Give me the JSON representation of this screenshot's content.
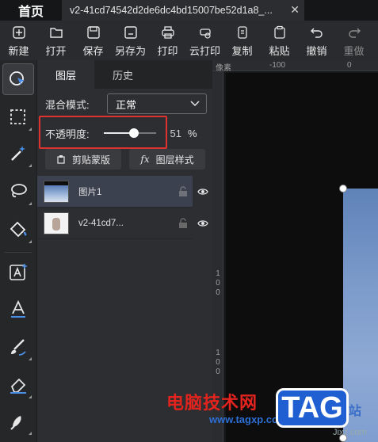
{
  "tabs": {
    "home": "首页",
    "document": "v2-41cd74542d2de6dc4bd15007be52d1a8_..."
  },
  "toolbar": {
    "items": [
      {
        "label": "新建",
        "icon": "new-icon"
      },
      {
        "label": "打开",
        "icon": "folder-open-icon"
      },
      {
        "label": "保存",
        "icon": "save-icon"
      },
      {
        "label": "另存为",
        "icon": "save-as-icon"
      },
      {
        "label": "打印",
        "icon": "printer-icon"
      },
      {
        "label": "云打印",
        "icon": "cloud-print-icon"
      },
      {
        "label": "复制",
        "icon": "copy-icon"
      },
      {
        "label": "粘贴",
        "icon": "paste-icon"
      },
      {
        "label": "撤销",
        "icon": "undo-icon"
      },
      {
        "label": "重做",
        "icon": "redo-icon"
      }
    ]
  },
  "panel": {
    "tabs": [
      "图层",
      "历史"
    ],
    "active_tab": "图层",
    "blend_mode": {
      "label": "混合模式:",
      "value": "正常"
    },
    "opacity": {
      "label": "不透明度:",
      "value": "51",
      "unit": "%",
      "level": 0.51
    },
    "buttons": {
      "clip_mask": "剪贴蒙版",
      "layer_style": "图层样式"
    },
    "layers": [
      {
        "name": "图片1",
        "selected": true
      },
      {
        "name": "v2-41cd7...",
        "selected": false
      }
    ]
  },
  "ruler": {
    "h_labels": [
      "像素",
      "-100",
      "0"
    ],
    "v_labels": [
      "1",
      "0",
      "0",
      "1",
      "0",
      "0"
    ]
  },
  "watermark": {
    "title": "电脑技术网",
    "url": "www.tagxp.com",
    "badge": "TAG",
    "side": "站",
    "side2": "Jixz.com"
  },
  "colors": {
    "highlight": "#e0322e",
    "accent_blue": "#4a8fe8",
    "badge_blue": "#1f5fd1"
  }
}
